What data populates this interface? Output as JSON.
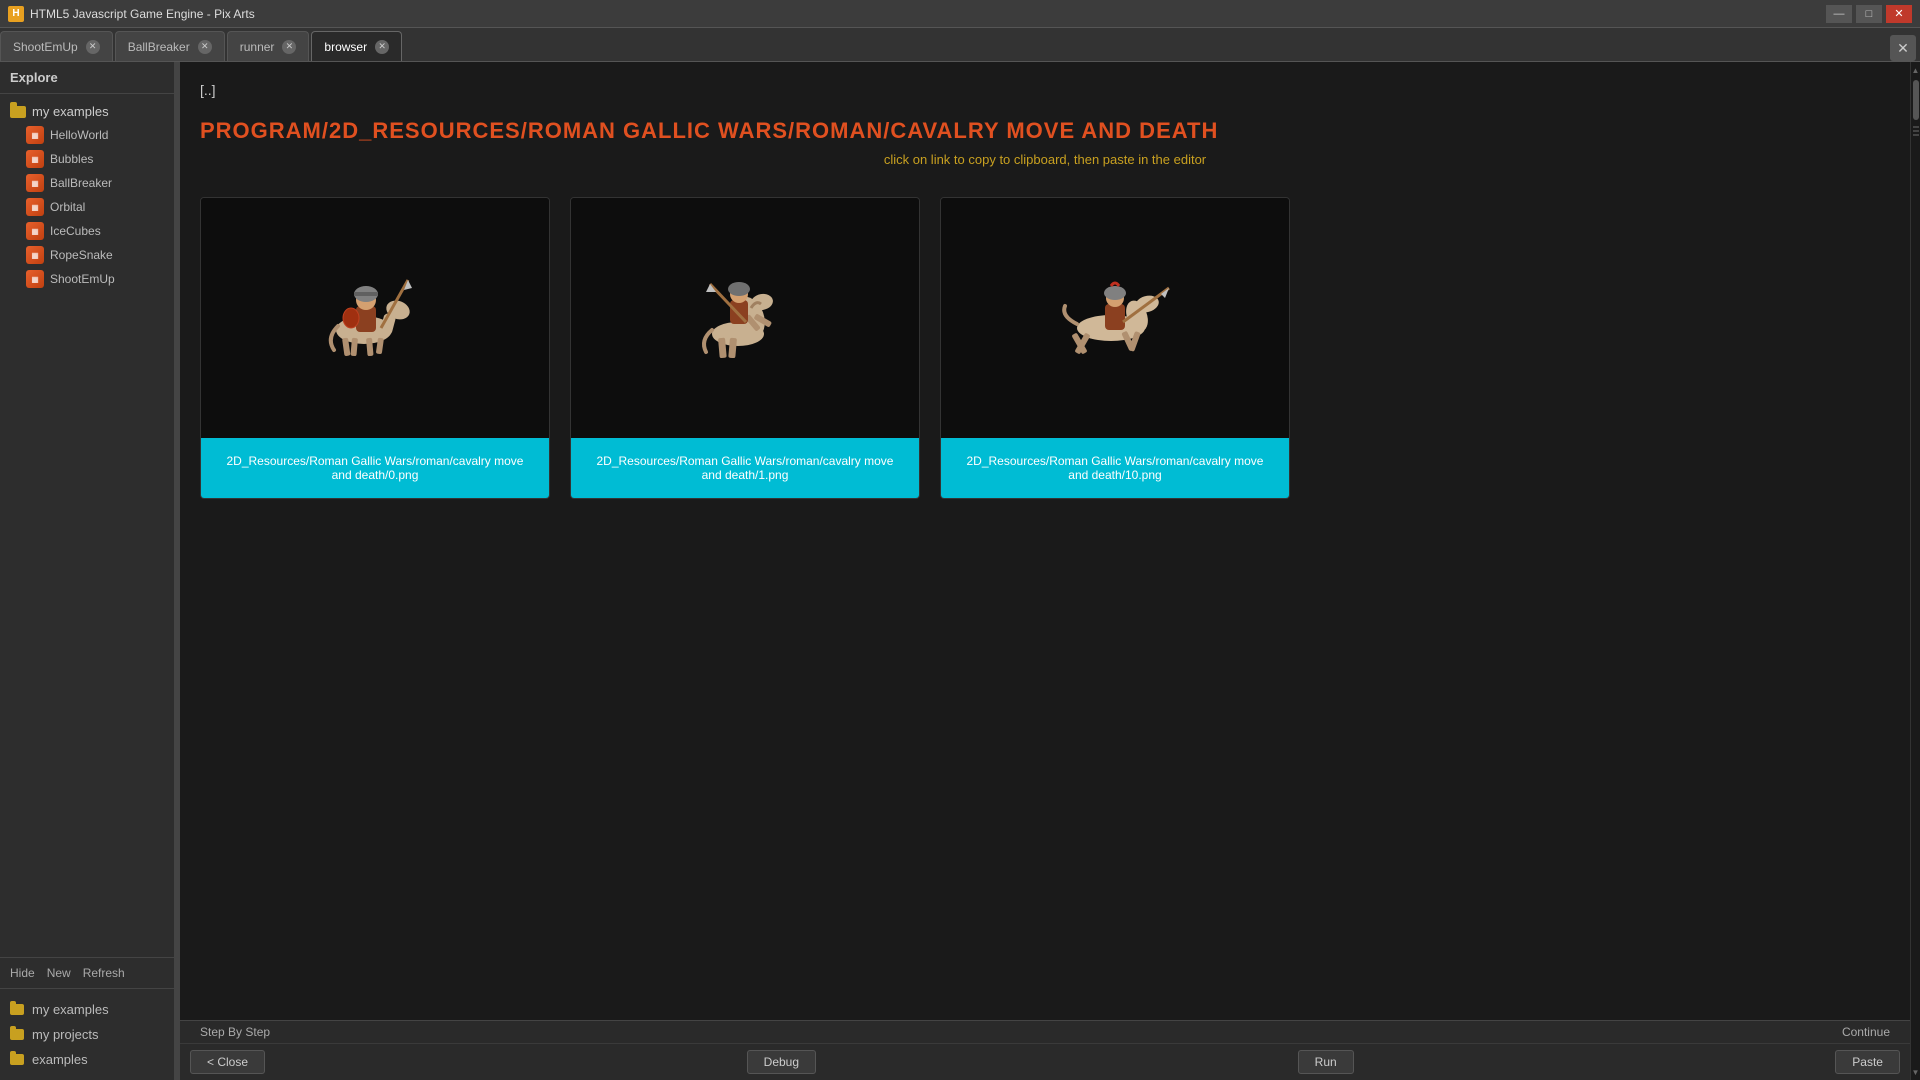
{
  "titleBar": {
    "title": "HTML5 Javascript Game Engine - Pix Arts",
    "iconLabel": "H",
    "minBtn": "—",
    "maxBtn": "□",
    "closeBtn": "✕"
  },
  "tabs": [
    {
      "id": "ShootEmUp",
      "label": "ShootEmUp",
      "active": false
    },
    {
      "id": "BallBreaker",
      "label": "BallBreaker",
      "active": false
    },
    {
      "id": "runner",
      "label": "runner",
      "active": false
    },
    {
      "id": "browser",
      "label": "browser",
      "active": true
    }
  ],
  "tabBarClose": "✕",
  "sidebar": {
    "header": "Explore",
    "myExamplesFolder": "my examples",
    "treeItems": [
      {
        "label": "HelloWorld"
      },
      {
        "label": "Bubbles"
      },
      {
        "label": "BallBreaker"
      },
      {
        "label": "Orbital"
      },
      {
        "label": "IceCubes"
      },
      {
        "label": "RopeSnake"
      },
      {
        "label": "ShootEmUp"
      }
    ],
    "actions": {
      "hide": "Hide",
      "new": "New",
      "refresh": "Refresh"
    },
    "bottomItems": [
      {
        "label": "my examples"
      },
      {
        "label": "my projects"
      },
      {
        "label": "examples"
      }
    ]
  },
  "browser": {
    "breadcrumb": "[..]",
    "pathHeading": "PROGRAM/2D_RESOURCES/ROMAN GALLIC WARS/ROMAN/CAVALRY MOVE AND DEATH",
    "pathHint": "click on link to copy to clipboard, then paste in the editor",
    "files": [
      {
        "label": "2D_Resources/Roman Gallic Wars/roman/cavalry move and death/0.png",
        "sprite": "variant1"
      },
      {
        "label": "2D_Resources/Roman Gallic Wars/roman/cavalry move and death/1.png",
        "sprite": "variant2"
      },
      {
        "label": "2D_Resources/Roman Gallic Wars/roman/cavalry move and death/10.png",
        "sprite": "variant3"
      }
    ]
  },
  "bottomBar": {
    "stepByStep": "Step By Step",
    "continue": "Continue",
    "closeBtn": "< Close",
    "debugBtn": "Debug",
    "runBtn": "Run",
    "pasteBtn": "Paste"
  }
}
